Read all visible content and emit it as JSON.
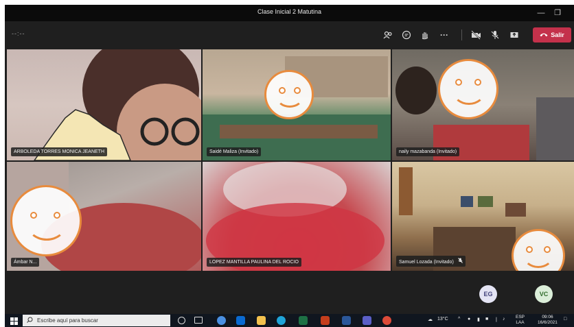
{
  "window": {
    "title": "Clase Inicial 2 Matutina",
    "minimize_icon": "minimize-icon",
    "maximize_icon": "maximize-icon"
  },
  "toolbar": {
    "timer": "--:--",
    "icons": [
      "participants-icon",
      "chat-icon",
      "raise-hand-icon",
      "more-options-icon",
      "camera-off-icon",
      "mic-off-icon",
      "share-icon"
    ],
    "leave_label": "Salir",
    "leave_color": "#c4314b"
  },
  "participants": [
    {
      "name": "ARBOLEDA TORRES MONICA JEANETH"
    },
    {
      "name": "Saidé Maliza (Invitado)"
    },
    {
      "name": "naily mazabanda (Invitado)"
    },
    {
      "name": "Ámbar N..."
    },
    {
      "name": "LOPEZ MANTILLA PAULINA DEL ROCIO"
    },
    {
      "name": "Samuel Lozada (Invitado)",
      "muted": true
    }
  ],
  "avatars": [
    {
      "initials": "EG"
    },
    {
      "initials": "VC"
    }
  ],
  "taskbar": {
    "search_placeholder": "Escribe aquí para buscar",
    "weather": "13°C",
    "language": "ESP",
    "layout": "LAA",
    "time": "09:06",
    "date": "16/6/2021"
  },
  "colors": {
    "accent": "#c4314b",
    "smiley": "#e88b3d"
  }
}
